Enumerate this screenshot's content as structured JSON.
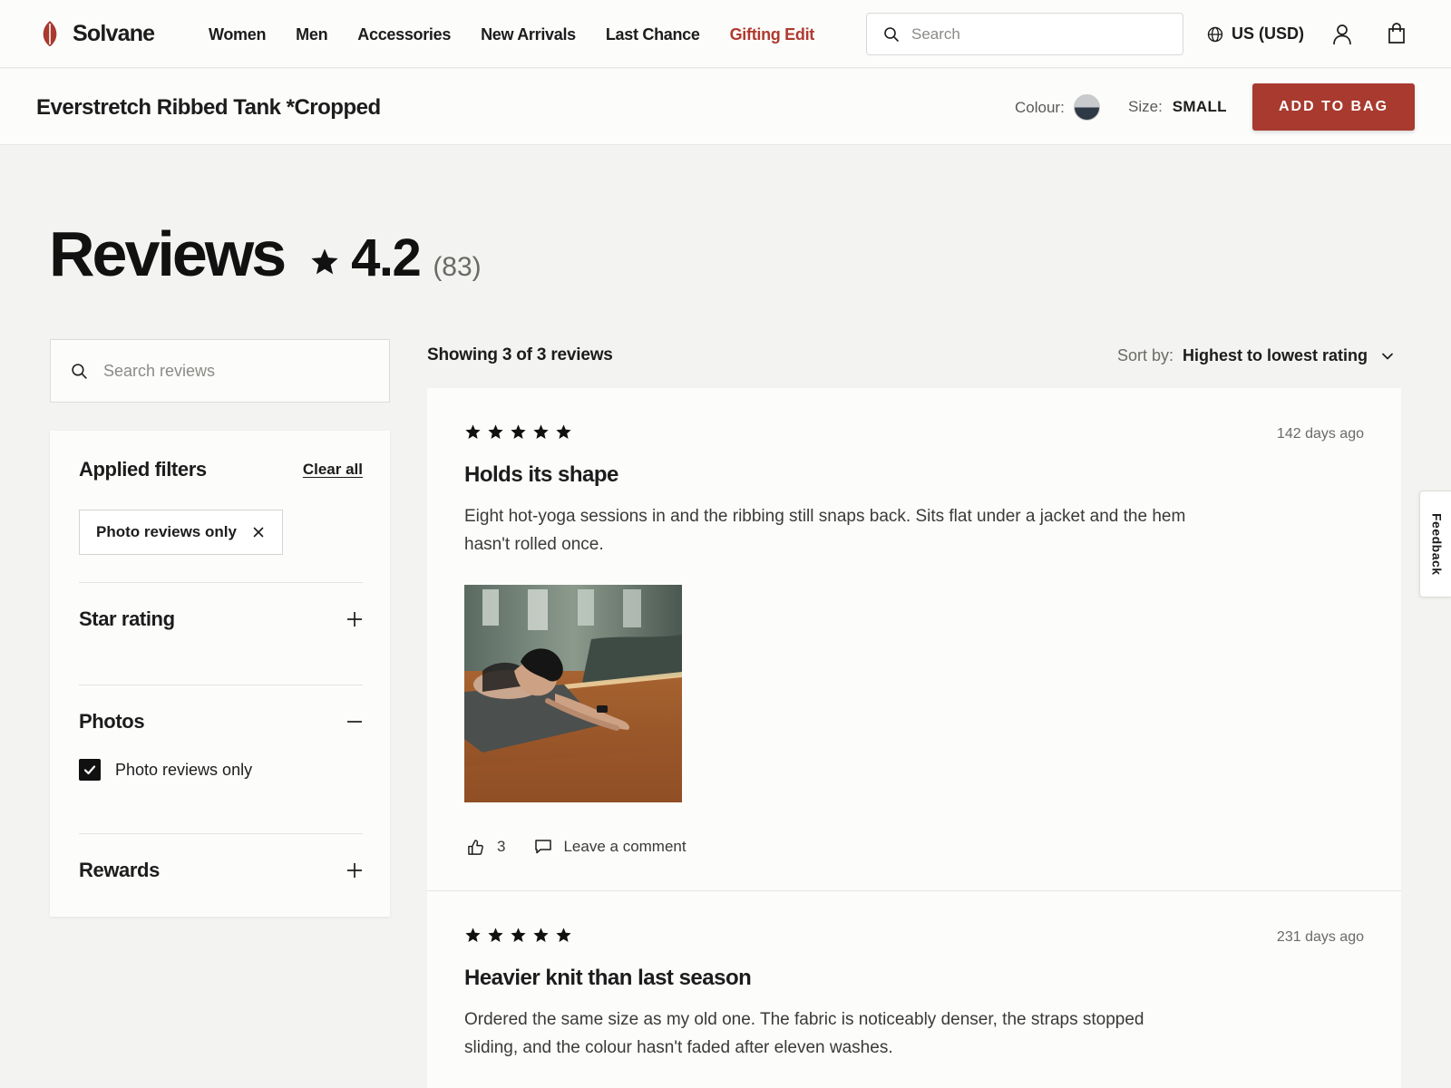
{
  "brand": {
    "name": "Solvane",
    "accent": "#a83a2f"
  },
  "nav": {
    "links": [
      {
        "label": "Women",
        "accent": false
      },
      {
        "label": "Men",
        "accent": false
      },
      {
        "label": "Accessories",
        "accent": false
      },
      {
        "label": "New Arrivals",
        "accent": false
      },
      {
        "label": "Last Chance",
        "accent": false
      },
      {
        "label": "Gifting Edit",
        "accent": true
      }
    ],
    "search_placeholder": "Search",
    "locale": "US (USD)",
    "icons": [
      "search-icon",
      "globe-icon",
      "account-icon",
      "bag-icon"
    ]
  },
  "product": {
    "name": "Everstretch Ribbed Tank *Cropped",
    "colour_label": "Colour:",
    "colour_swatch": [
      "#c8cacd",
      "#2e3946"
    ],
    "size_label": "Size:",
    "size_value": "SMALL",
    "add_to_bag": "ADD TO BAG"
  },
  "reviews": {
    "title": "Reviews",
    "rating": "4.2",
    "count": "(83)",
    "search_placeholder": "Search reviews",
    "showing": "Showing 3 of 3 reviews",
    "sort_label": "Sort by:",
    "sort_value": "Highest to lowest rating"
  },
  "filters": {
    "title": "Applied filters",
    "clear_all": "Clear all",
    "chip": "Photo reviews only",
    "sections": {
      "star_rating": "Star rating",
      "photos": "Photos",
      "rewards": "Rewards"
    },
    "photos_option": {
      "label": "Photo reviews only",
      "checked": true
    }
  },
  "review_items": [
    {
      "stars": 5,
      "date": "142 days ago",
      "title": "Holds its shape",
      "body": "Eight hot-yoga sessions in and the ribbing still snaps back. Sits flat under a jacket and the hem hasn't rolled once.",
      "has_photo": true,
      "helpful_count": "3",
      "comment_label": "Leave a comment"
    },
    {
      "stars": 5,
      "date": "231 days ago",
      "title": "Heavier knit than last season",
      "body": "Ordered the same size as my old one. The fabric is noticeably denser, the straps stopped sliding, and the colour hasn't faded after eleven washes."
    }
  ],
  "feedback": "Feedback"
}
